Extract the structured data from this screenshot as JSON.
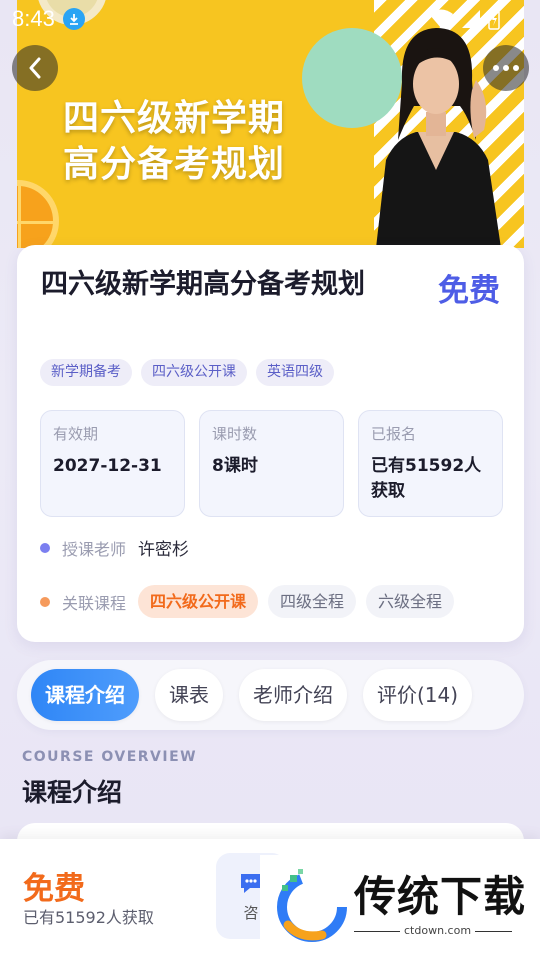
{
  "status_bar": {
    "time": "8:43"
  },
  "banner": {
    "title_line1": "四六级新学期",
    "title_line2": "高分备考规划"
  },
  "course": {
    "title": "四六级新学期高分备考规划",
    "price": "免费",
    "tags": [
      "新学期备考",
      "四六级公开课",
      "英语四级"
    ],
    "stats": [
      {
        "label": "有效期",
        "value": "2027-12-31"
      },
      {
        "label": "课时数",
        "value": "8课时"
      },
      {
        "label": "已报名",
        "value": "已有51592人获取"
      }
    ],
    "teacher_label": "授课老师",
    "teacher_name": "许密杉",
    "related_label": "关联课程",
    "related": [
      "四六级公开课",
      "四级全程",
      "六级全程"
    ]
  },
  "tabs": [
    "课程介绍",
    "课表",
    "老师介绍",
    "评价(14)"
  ],
  "overview": {
    "en": "COURSE OVERVIEW",
    "zh": "课程介绍"
  },
  "bottom": {
    "price": "免费",
    "count": "已有51592人获取",
    "consult_label": "咨"
  },
  "watermark": {
    "brand": "传统下载",
    "url": "ctdown.com"
  },
  "colors": {
    "accent_blue": "#4e5de6",
    "tab_active": "#2f86f6",
    "orange": "#f26a1b",
    "banner_yellow": "#f7c520"
  }
}
